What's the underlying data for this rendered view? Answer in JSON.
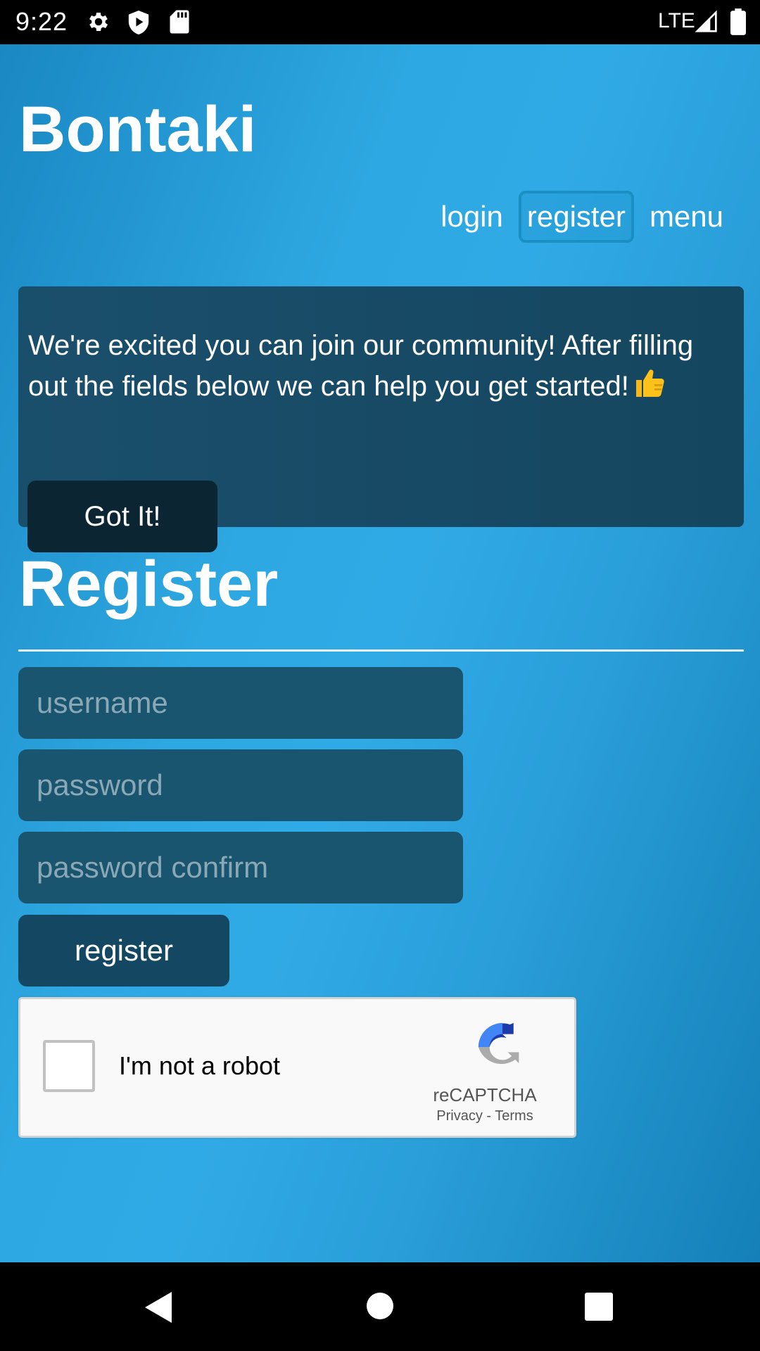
{
  "status_bar": {
    "time": "9:22",
    "network": "LTE",
    "icons": [
      "gear-icon",
      "shield-play-icon",
      "sd-card-icon",
      "signal-icon",
      "battery-icon"
    ]
  },
  "header": {
    "brand": "Bontaki",
    "nav": [
      {
        "label": "login",
        "active": false
      },
      {
        "label": "register",
        "active": true
      },
      {
        "label": "menu",
        "active": false
      }
    ]
  },
  "notice": {
    "message": "We're excited you can join our community! After filling out the fields below we can help you get started!",
    "emoji_icon": "thumbs-up-icon",
    "button_label": "Got It!"
  },
  "form": {
    "title": "Register",
    "fields": {
      "username_placeholder": "username",
      "username_value": "",
      "password_placeholder": "password",
      "password_value": "",
      "password_confirm_placeholder": "password confirm",
      "password_confirm_value": ""
    },
    "submit_label": "register"
  },
  "recaptcha": {
    "label": "I'm not a robot",
    "brand": "reCAPTCHA",
    "privacy": "Privacy",
    "separator": " - ",
    "terms": "Terms",
    "checked": false
  },
  "colors": {
    "page_gradient_light": "#30aae6",
    "page_gradient_dark": "#1580b8",
    "panel": "#1a4f6c",
    "field": "#1a556f",
    "button_dark": "#0b2533"
  }
}
